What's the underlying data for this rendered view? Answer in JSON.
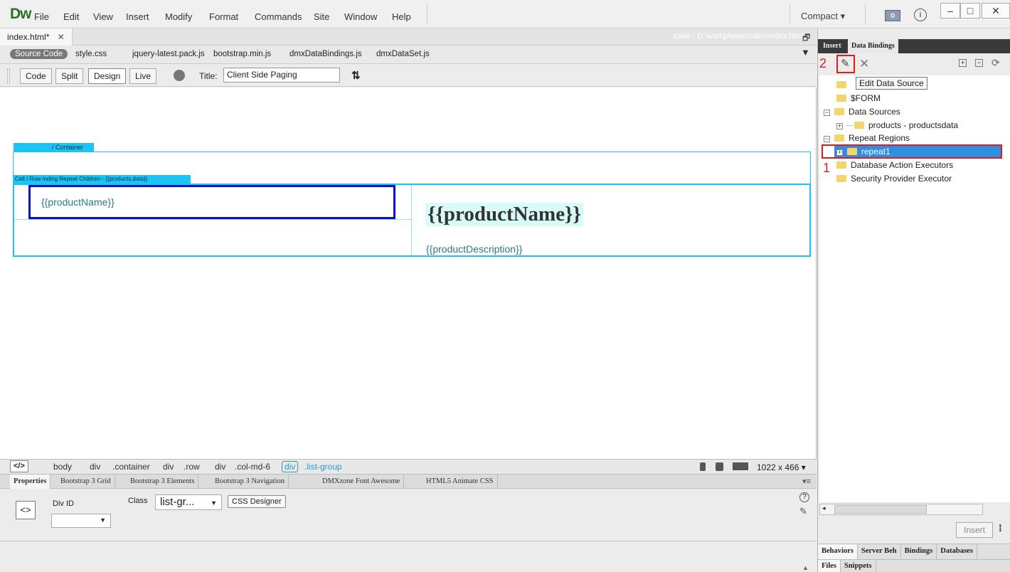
{
  "app": {
    "logo": "Dw",
    "menu": [
      "File",
      "Edit",
      "View",
      "Insert",
      "Modify",
      "Format",
      "Commands",
      "Site",
      "Window",
      "Help"
    ],
    "workspace": "Compact ▾"
  },
  "document": {
    "tab_label": "index.html*",
    "path": "cake - D:\\wamp\\www\\cake\\index.html",
    "source_code_label": "Source Code",
    "related_files": [
      "style.css",
      "jquery-latest.pack.js",
      "bootstrap.min.js",
      "dmxDataBindings.js",
      "dmxDataSet.js"
    ]
  },
  "toolbar": {
    "code": "Code",
    "split": "Split",
    "design": "Design",
    "live": "Live",
    "title_label": "Title:",
    "title_value": "Client Side Paging"
  },
  "canvas": {
    "container_tag": "/ Container",
    "row_tag": "Cell / Row inding Repeat Children - {{products.data}}",
    "product_name_small": "{{productName}}",
    "product_name_big": "{{productName}}",
    "product_description": "{{productDescription}}"
  },
  "tag_selector": {
    "code_icon": "</>",
    "tags": [
      "body",
      "div",
      ".container",
      "div",
      ".row",
      "div",
      ".col-md-6"
    ],
    "current_tag": "div",
    "current_class": ".list-group",
    "window_size": "1022 x 466 ▾"
  },
  "properties": {
    "tabs": [
      "Properties",
      "Bootstrap 3 Grid",
      "Bootstrap 3 Elements",
      "Bootstrap 3 Navigation",
      "DMXzone Font Awesome",
      "HTML5 Animate CSS"
    ],
    "tag_icon": "<>",
    "div_id_label": "Div ID",
    "class_label": "Class",
    "class_value": "list-gr...",
    "css_designer": "CSS Designer"
  },
  "right_panel": {
    "tabs": [
      "Insert",
      "Data Bindings"
    ],
    "tooltip": "Edit Data Source",
    "annotation_1": "1",
    "annotation_2": "2",
    "tree": {
      "form": "$FORM",
      "data_sources": "Data Sources",
      "products": "products - productsdata",
      "repeat_regions": "Repeat Regions",
      "repeat1": "repeat1",
      "db_executors": "Database Action Executors",
      "security": "Security Provider Executor"
    },
    "insert_button": "Insert",
    "bottom_tabs_1": [
      "Behaviors",
      "Server Beh",
      "Bindings",
      "Databases"
    ],
    "bottom_tabs_2": [
      "Files",
      "Snippets"
    ]
  }
}
